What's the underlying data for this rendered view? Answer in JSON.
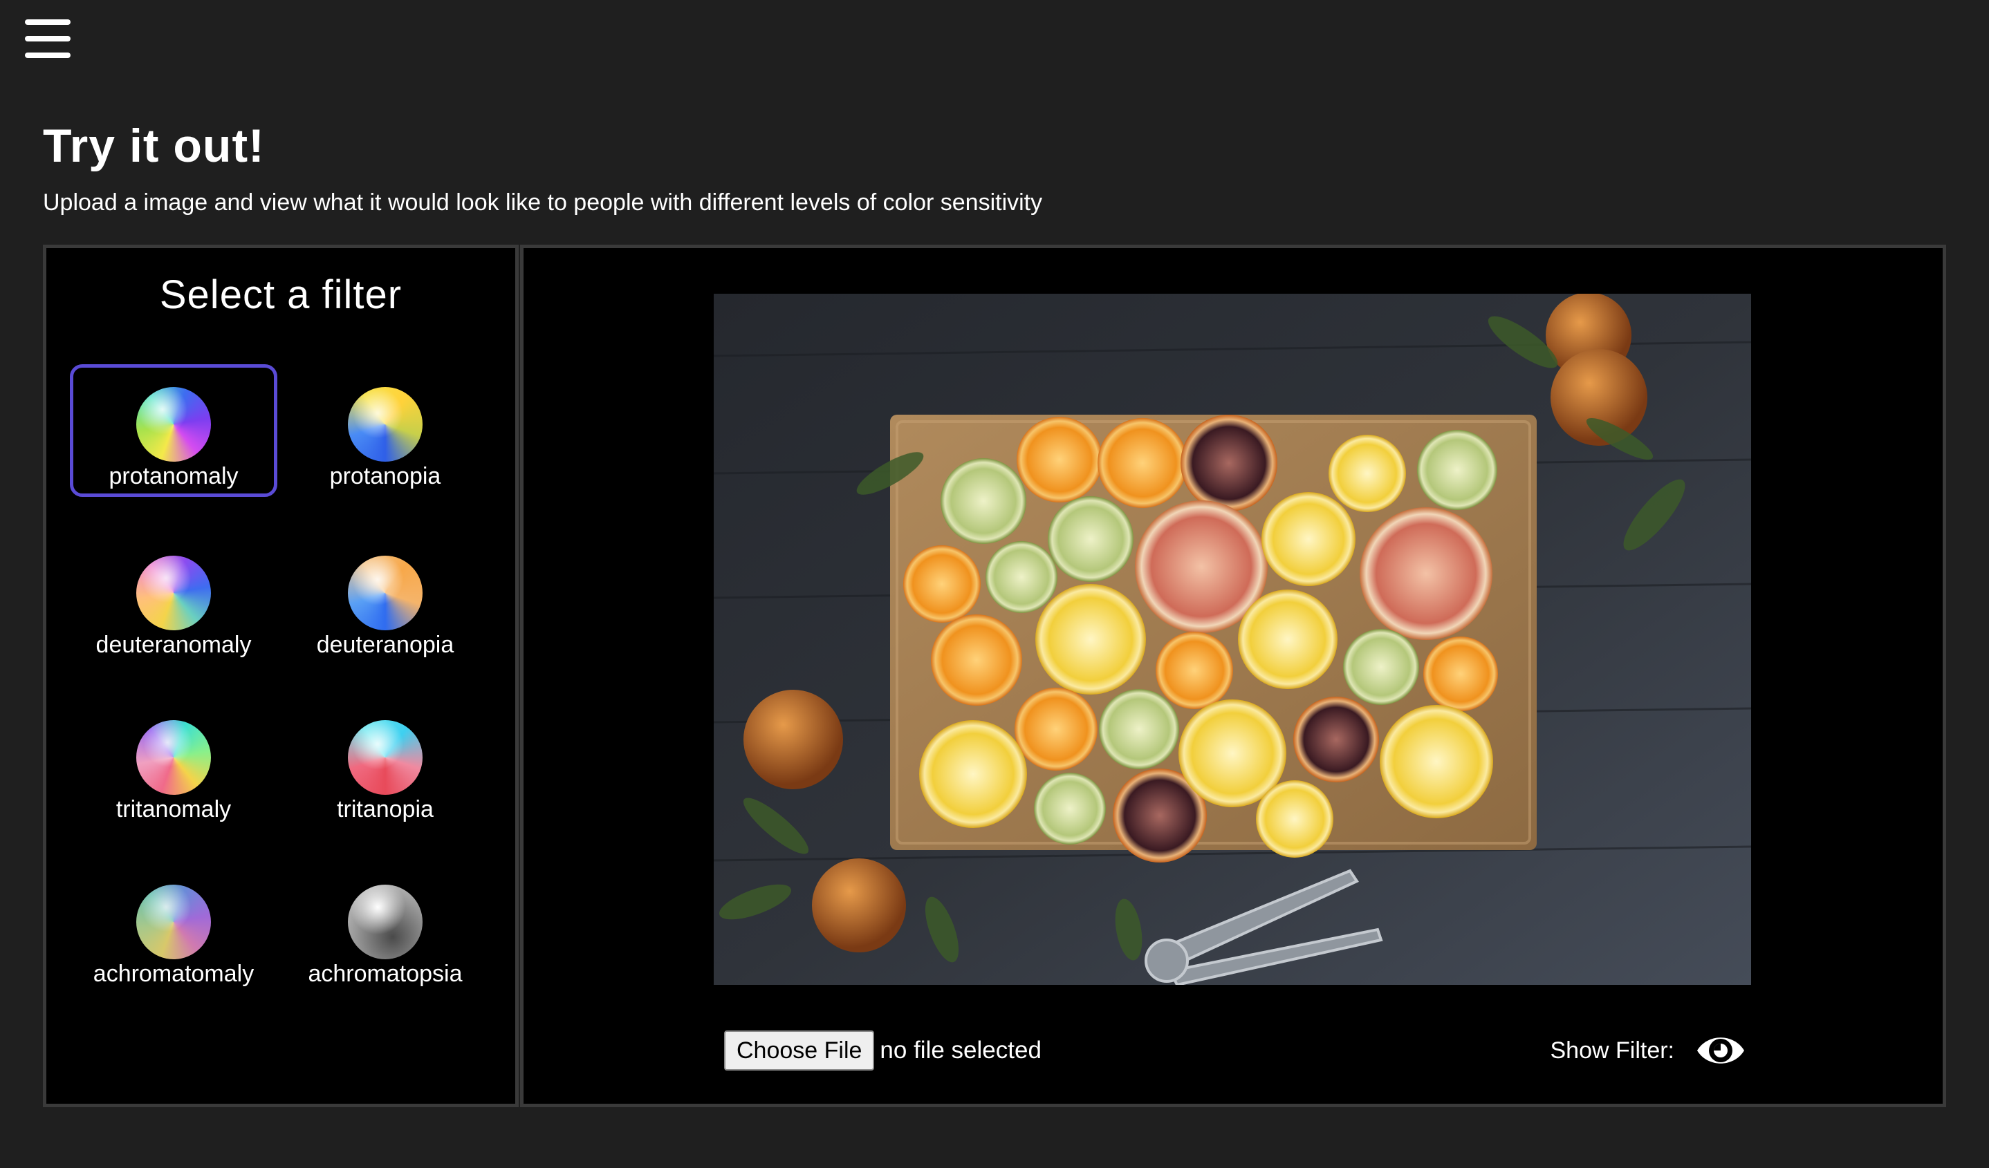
{
  "header": {
    "menu_icon": "hamburger-menu-icon"
  },
  "intro": {
    "title": "Try it out!",
    "subtitle": "Upload a image and view what it would look like to people with different levels of color sensitivity"
  },
  "filter_panel": {
    "heading": "Select a filter",
    "selected": "protanomaly",
    "selected_color": "#5a4bd6",
    "filters": [
      {
        "id": "protanomaly",
        "label": "protanomaly"
      },
      {
        "id": "protanopia",
        "label": "protanopia"
      },
      {
        "id": "deuteranomaly",
        "label": "deuteranomaly"
      },
      {
        "id": "deuteranopia",
        "label": "deuteranopia"
      },
      {
        "id": "tritanomaly",
        "label": "tritanomaly"
      },
      {
        "id": "tritanopia",
        "label": "tritanopia"
      },
      {
        "id": "achromatomaly",
        "label": "achromatomaly"
      },
      {
        "id": "achromatopsia",
        "label": "achromatopsia"
      }
    ]
  },
  "viewer": {
    "image_subject": "sliced citrus fruit on a wooden cutting board",
    "file_button_label": "Choose File",
    "file_status": "no file selected",
    "show_filter_label": "Show Filter:",
    "show_filter_icon": "eye-icon"
  },
  "colors": {
    "page_background": "#1f1f1f",
    "panel_background": "#000000",
    "panel_border": "#3a3a3a",
    "text": "#ffffff"
  }
}
